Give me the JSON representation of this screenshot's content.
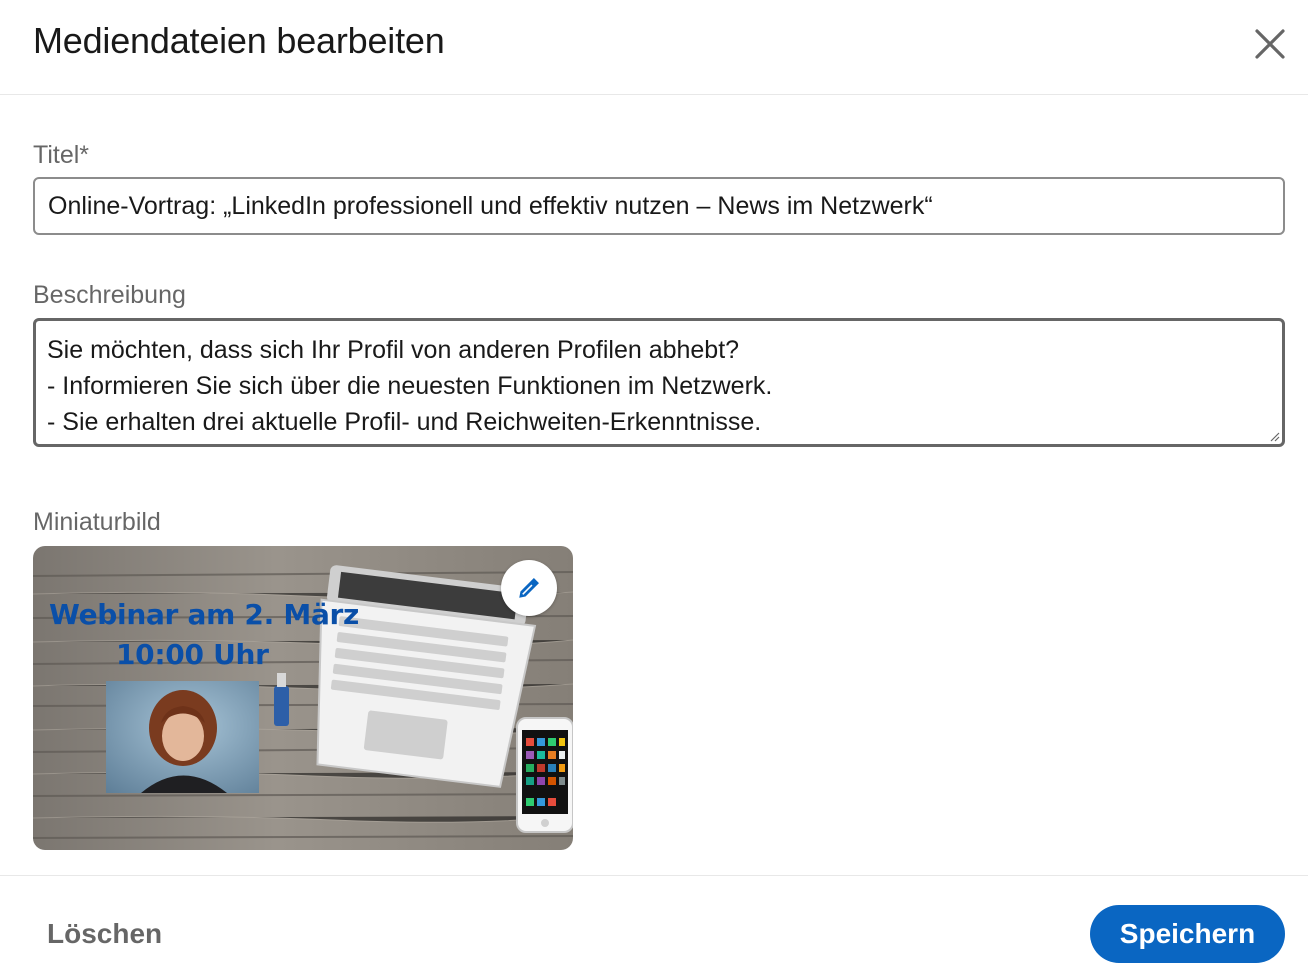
{
  "dialog": {
    "title": "Mediendateien bearbeiten",
    "close_icon": "close-icon"
  },
  "form": {
    "title_label": "Titel*",
    "title_value": "Online-Vortrag: „LinkedIn professionell und effektiv nutzen – News im Netzwerk“",
    "description_label": "Beschreibung",
    "description_lines": [
      "Sie möchten, dass sich Ihr Profil von anderen Profilen abhebt?",
      "- Informieren Sie sich über die neuesten Funktionen im Netzwerk.",
      "- Sie erhalten drei aktuelle Profil- und Reichweiten-Erkenntnisse."
    ],
    "thumbnail_label": "Miniaturbild",
    "thumbnail": {
      "line1": "Webinar am 2. März",
      "line2": "10:00 Uhr",
      "edit_icon": "pencil-icon"
    }
  },
  "footer": {
    "delete_label": "Löschen",
    "save_label": "Speichern"
  },
  "colors": {
    "primary": "#0a66c2",
    "thumb_text": "#0a4fa8",
    "muted_text": "#666666"
  }
}
